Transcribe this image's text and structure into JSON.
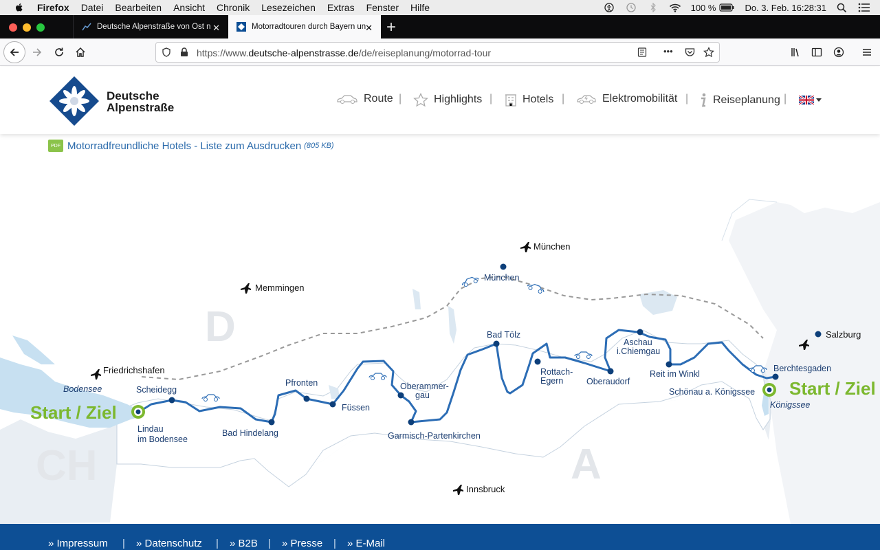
{
  "menubar": {
    "app": "Firefox",
    "items": [
      "Datei",
      "Bearbeiten",
      "Ansicht",
      "Chronik",
      "Lesezeichen",
      "Extras",
      "Fenster",
      "Hilfe"
    ],
    "battery": "100 %",
    "datetime": "Do. 3. Feb.  16:28:31"
  },
  "tabs": [
    {
      "label": "Deutsche Alpenstraße von Ost nach West",
      "close": "✕"
    },
    {
      "label": "Motorradtouren durch Bayern und Tirol",
      "close": "✕"
    }
  ],
  "newtab": "+",
  "urlbar": {
    "prefix": "https://www.",
    "domain": "deutsche-alpenstrasse.de",
    "path": "/de/reiseplanung/motorrad-tour",
    "page_actions": "•••"
  },
  "site": {
    "logo_line1": "Deutsche",
    "logo_line2": "Alpenstraße",
    "nav": [
      "Route",
      "Highlights",
      "Hotels",
      "Elektromobilität",
      "Reiseplanung"
    ],
    "separator": "|"
  },
  "pdf": {
    "icon_text": "PDF",
    "link": "Motorradfreundliche Hotels - Liste zum Ausdrucken",
    "size": "(805 KB)"
  },
  "map": {
    "countries": [
      "D",
      "CH",
      "A"
    ],
    "start_ziel": "Start / Ziel",
    "lakes": [
      "Bodensee",
      "Königssee"
    ],
    "airports": [
      "München",
      "Memmingen",
      "Friedrichshafen",
      "Innsbruck",
      "Salzburg"
    ],
    "towns": {
      "scheidegg": "Scheidegg",
      "lindau1": "Lindau",
      "lindau2": "im Bodensee",
      "hindelang": "Bad Hindelang",
      "pfronten": "Pfronten",
      "fuessen": "Füssen",
      "oberammergau1": "Oberammer-",
      "oberammergau2": "gau",
      "garmisch": "Garmisch-Partenkirchen",
      "badtoelz": "Bad Tölz",
      "muenchen": "München",
      "rottach1": "Rottach-",
      "rottach2": "Egern",
      "oberaudorf": "Oberaudorf",
      "aschau1": "Aschau",
      "aschau2": "i.Chiemgau",
      "reit": "Reit im Winkl",
      "schoenau": "Schönau a. Königssee",
      "berchtesgaden": "Berchtesgaden"
    }
  },
  "footer": [
    "Impressum",
    "Datenschutz",
    "B2B",
    "Presse",
    "E-Mail"
  ],
  "footer_marker": "»",
  "colors": {
    "route": "#2c6db5",
    "town_dot": "#0d3f7a",
    "start_green": "#7cb82f",
    "footer_bg": "#0d4f95",
    "link": "#2a6aab"
  }
}
